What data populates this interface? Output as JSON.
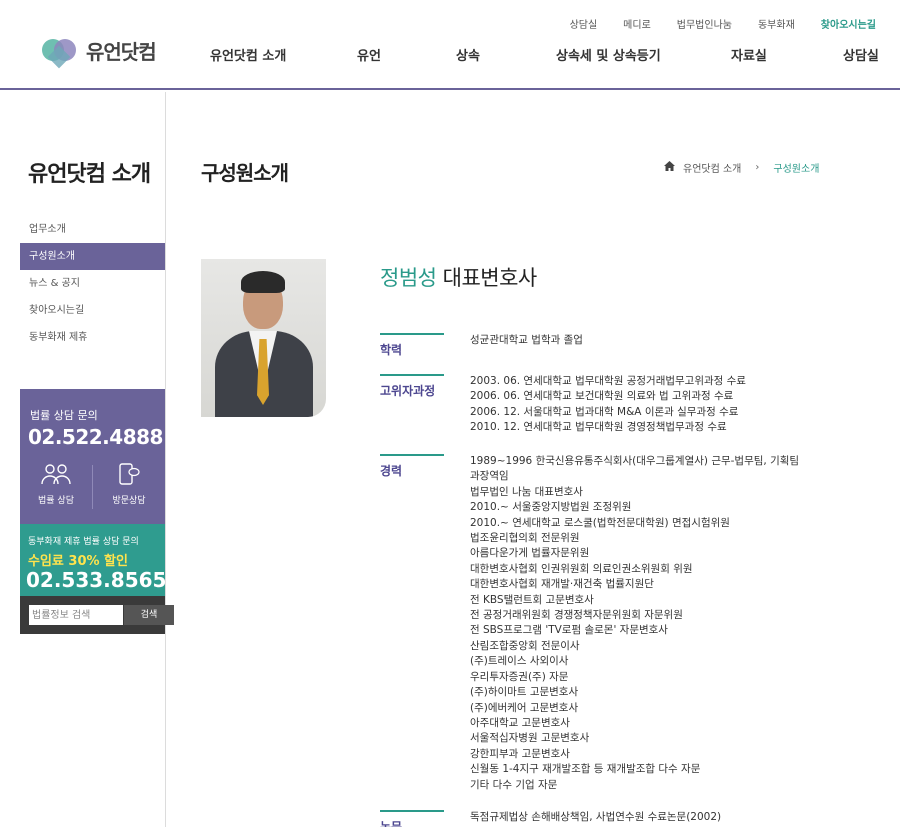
{
  "util_links": [
    "상담실",
    "메디로",
    "법무법인나눔",
    "동부화재",
    "찾아오시는길"
  ],
  "logo": {
    "text": "유언닷컴"
  },
  "gnb": [
    "유언닷컴 소개",
    "유언",
    "상속",
    "상속세 및 상속등기",
    "자료실",
    "상담실"
  ],
  "sidebar": {
    "title": "유언닷컴 소개",
    "items": [
      "업무소개",
      "구성원소개",
      "뉴스 & 공지",
      "찾아오시는길",
      "동부화재 제휴"
    ],
    "active_index": 1,
    "consult": {
      "title": "법률 상담 문의",
      "phone": "02.522.4888",
      "btn1": "법률 상담",
      "btn2": "방문상담"
    },
    "partner": {
      "title": "동부화재 제휴 법률 상담 문의",
      "promo": "수임료 30% 할인",
      "phone": "02.533.8565"
    },
    "search": {
      "placeholder": "법률정보 검색",
      "button": "검색"
    }
  },
  "page_title": "구성원소개",
  "breadcrumb": {
    "parent": "유언닷컴 소개",
    "current": "구성원소개"
  },
  "profile": {
    "name": "정범성",
    "role": "대표변호사",
    "education_label": "학력",
    "education": [
      "성균관대학교 법학과 졸업"
    ],
    "advanced_label": "고위자과정",
    "advanced": [
      "2003. 06. 연세대학교 법무대학원 공정거래법무고위과정 수료",
      "2006. 06. 연세대학교 보건대학원 의료와 법 고위과정 수료",
      "2006. 12. 서울대학교 법과대학 M&A 이론과 실무과정 수료",
      "2010. 12. 연세대학교 법무대학원 경영정책법무과정 수료"
    ],
    "career_label": "경력",
    "career": [
      "1989~1996 한국신용유통주식회사(대우그룹계열사) 근무-법무팀, 기획팀",
      "과장역임",
      "법무법인 나눔 대표변호사",
      "2010.~ 서울중앙지방법원 조정위원",
      "2010.~ 연세대학교 로스쿨(법학전문대학원) 면접시험위원",
      "법조윤리협의회 전문위원",
      "아름다운가게 법률자문위원",
      "대한변호사협회 인권위원회 의료인권소위원회 위원",
      "대한변호사협회 재개발·재건축 법률지원단",
      "전 KBS탤런트회 고문변호사",
      "전 공정거래위원회 경쟁정책자문위원회 자문위원",
      "전 SBS프로그램 'TV로펌 솔로몬' 자문변호사",
      "산림조합중앙회 전문이사",
      "(주)트레이스 사외이사",
      "우리투자증권(주) 자문",
      "(주)하이마트 고문변호사",
      "(주)에버케어 고문변호사",
      "아주대학교 고문변호사",
      "서울적십자병원 고문변호사",
      "강한피부과 고문변호사",
      "신월동 1-4지구 재개발조합 등 재개발조합 다수 자문",
      "기타 다수 기업 자문"
    ],
    "paper_label": "논문",
    "papers": [
      "독점규제법상 손해배상책임, 사법연수원 수료논문(2002)"
    ]
  }
}
